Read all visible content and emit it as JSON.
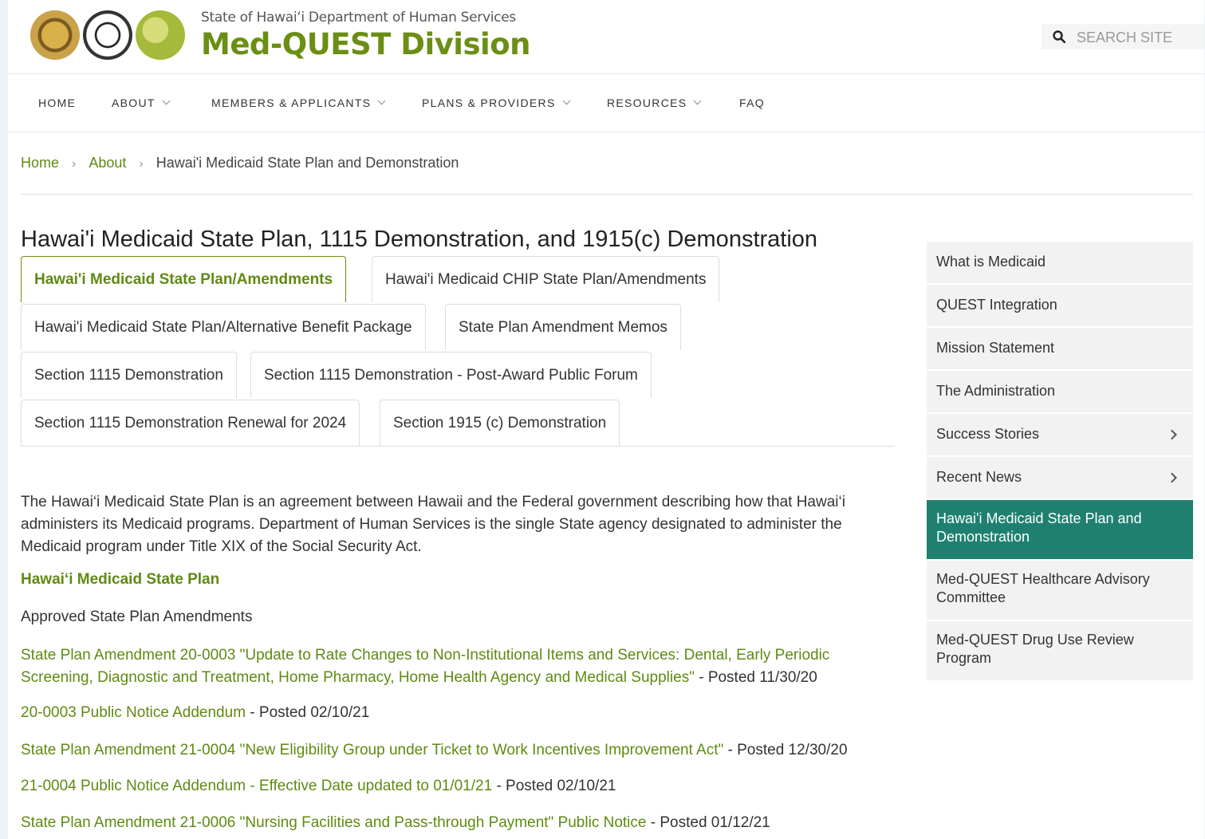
{
  "header": {
    "agency": "State of Hawaiʻi Department of Human Services",
    "division": "Med-QUEST Division",
    "search_placeholder": "SEARCH SITE"
  },
  "nav": {
    "items": [
      {
        "label": "HOME",
        "dropdown": false
      },
      {
        "label": "ABOUT",
        "dropdown": true
      },
      {
        "label": "MEMBERS & APPLICANTS",
        "dropdown": true
      },
      {
        "label": "PLANS & PROVIDERS",
        "dropdown": true
      },
      {
        "label": "RESOURCES",
        "dropdown": true
      },
      {
        "label": "FAQ",
        "dropdown": false
      }
    ]
  },
  "breadcrumb": {
    "home": "Home",
    "about": "About",
    "current": "Hawai'i Medicaid State Plan and Demonstration"
  },
  "page_title": "Hawai'i Medicaid State Plan, 1115 Demonstration, and 1915(c) Demonstration",
  "tabs": [
    {
      "label": "Hawai'i Medicaid State Plan/Amendments",
      "active": true
    },
    {
      "label": "Hawai'i Medicaid CHIP State Plan/Amendments",
      "active": false
    },
    {
      "label": "Hawai'i Medicaid State Plan/Alternative Benefit Package",
      "active": false
    },
    {
      "label": "State Plan Amendment Memos",
      "active": false
    },
    {
      "label": "Section 1115 Demonstration",
      "active": false
    },
    {
      "label": "Section 1115 Demonstration - Post-Award Public Forum",
      "active": false
    },
    {
      "label": "Section 1115 Demonstration Renewal for 2024",
      "active": false
    },
    {
      "label": "Section 1915 (c) Demonstration",
      "active": false
    }
  ],
  "content": {
    "intro": "The Hawai‘i Medicaid State Plan is an agreement between Hawaii and the Federal government describing how that Hawai‘i administers its Medicaid programs.  Department of Human Services is the single State agency designated to administer the Medicaid program under Title XIX of the Social Security Act.",
    "subhead": "Hawai‘i Medicaid State Plan",
    "approved": "Approved State Plan Amendments",
    "docs": [
      {
        "link": "State Plan Amendment 20-0003 \"Update to Rate Changes to Non-Institutional Items and Services: Dental, Early Periodic Screening, Diagnostic and Treatment, Home Pharmacy, Home Health Agency and Medical Supplies\"",
        "posted": " - Posted 11/30/20"
      },
      {
        "link": "20-0003 Public Notice Addendum",
        "posted": " - Posted 02/10/21"
      },
      {
        "link": "State Plan Amendment 21-0004 \"New Eligibility Group under Ticket to Work Incentives Improvement Act\"",
        "posted": " - Posted 12/30/20"
      },
      {
        "link": "21-0004 Public Notice Addendum -  Effective Date updated to 01/01/21",
        "posted": " - Posted 02/10/21"
      },
      {
        "link": "State Plan Amendment 21-0006 \"Nursing Facilities and Pass-through Payment\" Public Notice",
        "posted": " - Posted 01/12/21"
      }
    ]
  },
  "sidebar": {
    "items": [
      {
        "label": "What is Medicaid",
        "arrow": false,
        "active": false
      },
      {
        "label": "QUEST Integration",
        "arrow": false,
        "active": false
      },
      {
        "label": "Mission Statement",
        "arrow": false,
        "active": false
      },
      {
        "label": "The Administration",
        "arrow": false,
        "active": false
      },
      {
        "label": "Success Stories",
        "arrow": true,
        "active": false
      },
      {
        "label": "Recent News",
        "arrow": true,
        "active": false
      },
      {
        "label": "Hawai'i Medicaid State Plan and Demonstration",
        "arrow": false,
        "active": true
      },
      {
        "label": "Med-QUEST Healthcare Advisory Committee",
        "arrow": false,
        "active": false
      },
      {
        "label": "Med-QUEST Drug Use Review Program",
        "arrow": false,
        "active": false
      }
    ]
  },
  "colors": {
    "brand_green": "#6b8e14",
    "link_green": "#5f8a12",
    "sidebar_active": "#1f8070"
  }
}
